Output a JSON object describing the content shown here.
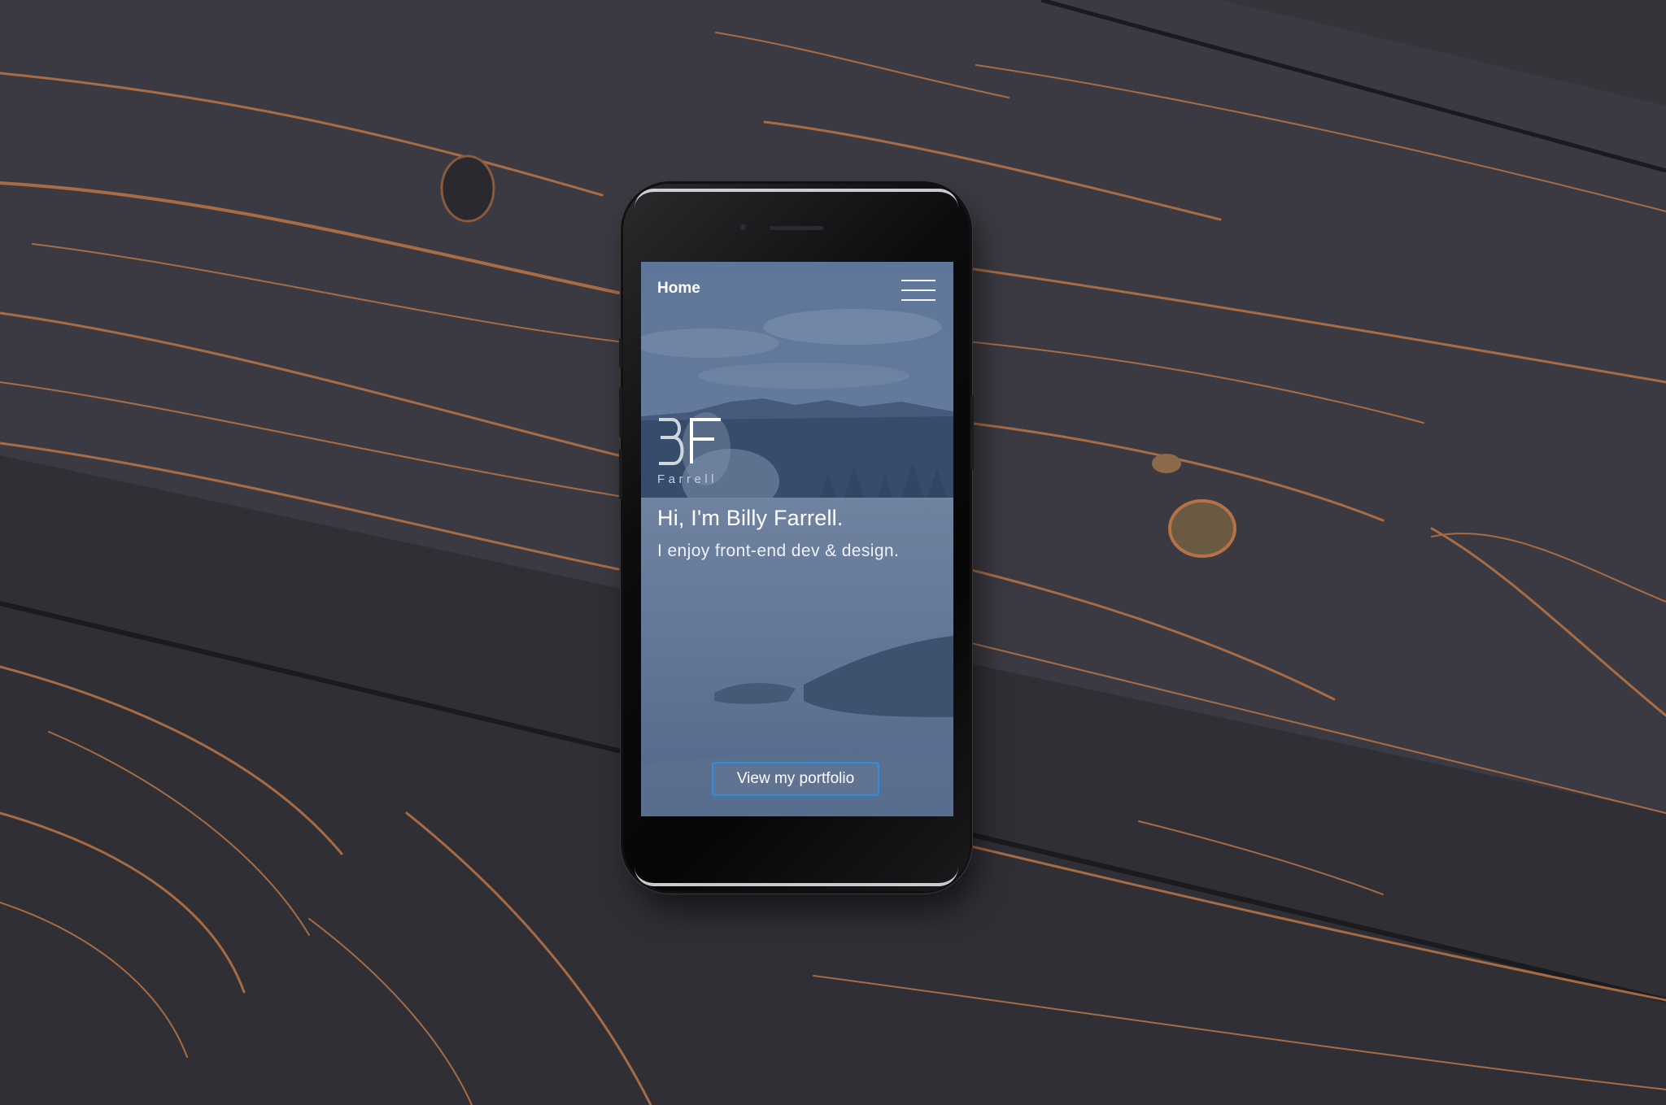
{
  "nav": {
    "home_label": "Home",
    "menu_icon": "hamburger-menu-icon"
  },
  "logo": {
    "monogram": "BF",
    "wordmark": "Farrell"
  },
  "hero": {
    "title": "Hi, I'm Billy Farrell.",
    "subtitle": "I enjoy front-end dev & design."
  },
  "cta": {
    "label": "View my portfolio"
  },
  "colors": {
    "wood": "#3a3940",
    "wood_grain": "#b9764a",
    "screen_overlay": "#4c6483",
    "cta_border": "#2d8ee8",
    "text": "#ffffff"
  }
}
